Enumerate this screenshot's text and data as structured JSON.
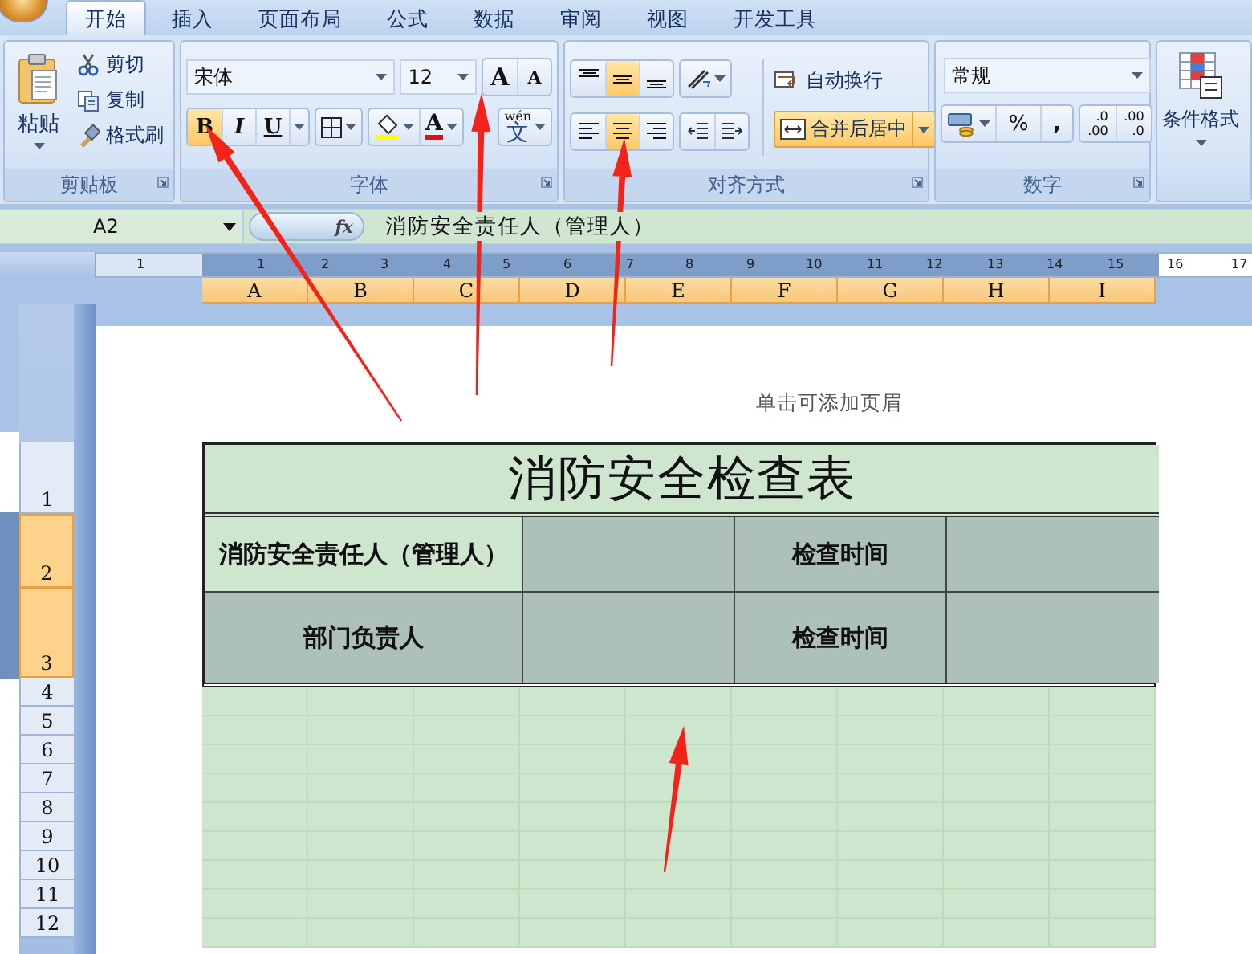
{
  "tabs": [
    {
      "label": "开始",
      "selected": true
    },
    {
      "label": "插入",
      "selected": false
    },
    {
      "label": "页面布局",
      "selected": false
    },
    {
      "label": "公式",
      "selected": false
    },
    {
      "label": "数据",
      "selected": false
    },
    {
      "label": "审阅",
      "selected": false
    },
    {
      "label": "视图",
      "selected": false
    },
    {
      "label": "开发工具",
      "selected": false
    }
  ],
  "ribbon": {
    "clipboard": {
      "label": "剪贴板",
      "paste": "粘贴",
      "items": [
        {
          "kind": "cut",
          "label": "剪切"
        },
        {
          "kind": "copy",
          "label": "复制"
        },
        {
          "kind": "painter",
          "label": "格式刷"
        }
      ]
    },
    "font": {
      "label": "字体",
      "font_name": "宋体",
      "font_size": "12",
      "grow": "A",
      "shrink": "A",
      "bold": {
        "label": "B",
        "selected": true
      },
      "italic": {
        "label": "I",
        "selected": false
      },
      "underline": {
        "label": "U",
        "selected": false
      },
      "font_color": "A",
      "phonetic_top": "wén",
      "phonetic": "文"
    },
    "alignment": {
      "label": "对齐方式",
      "vertical": [
        {
          "kind": "top",
          "selected": false
        },
        {
          "kind": "middle",
          "selected": true
        },
        {
          "kind": "bottom",
          "selected": false
        }
      ],
      "horizontal": [
        {
          "kind": "left",
          "selected": false
        },
        {
          "kind": "center",
          "selected": true
        },
        {
          "kind": "right",
          "selected": false
        }
      ],
      "wrap_text": "自动换行",
      "merge_center": {
        "label": "合并后居中",
        "selected": true
      }
    },
    "number": {
      "label": "数字",
      "format": "常规",
      "percent": "%",
      "comma": ",",
      "increase_decimal": [
        ".0",
        ".00"
      ],
      "decrease_decimal": [
        ".00",
        ".0"
      ]
    },
    "styles": {
      "conditional_format": "条件格式"
    }
  },
  "formula_bar": {
    "name_box": "A2",
    "function_label": "fx",
    "formula": "消防安全责任人（管理人）"
  },
  "ruler": [
    "1",
    "1",
    "2",
    "3",
    "4",
    "5",
    "6",
    "7",
    "8",
    "9",
    "10",
    "11",
    "12",
    "13",
    "14",
    "15",
    "16",
    "17"
  ],
  "columns": [
    {
      "label": "A",
      "selected": true
    },
    {
      "label": "B",
      "selected": true
    },
    {
      "label": "C",
      "selected": true
    },
    {
      "label": "D",
      "selected": true
    },
    {
      "label": "E",
      "selected": true
    },
    {
      "label": "F",
      "selected": true
    },
    {
      "label": "G",
      "selected": true
    },
    {
      "label": "H",
      "selected": true
    },
    {
      "label": "I",
      "selected": true
    }
  ],
  "rows": [
    {
      "label": "1",
      "selected": false
    },
    {
      "label": "2",
      "selected": true
    },
    {
      "label": "3",
      "selected": true
    },
    {
      "label": "4",
      "selected": false
    },
    {
      "label": "5",
      "selected": false
    },
    {
      "label": "6",
      "selected": false
    },
    {
      "label": "7",
      "selected": false
    },
    {
      "label": "8",
      "selected": false
    },
    {
      "label": "9",
      "selected": false
    },
    {
      "label": "10",
      "selected": false
    },
    {
      "label": "11",
      "selected": false
    },
    {
      "label": "12",
      "selected": false
    }
  ],
  "page_header_hint": "单击可添加页眉",
  "sheet": {
    "title": "消防安全检查表",
    "rows": [
      [
        {
          "kind": "label",
          "text": "消防安全责任人（管理人）",
          "highlighted": false
        },
        {
          "kind": "blank",
          "highlighted": true
        },
        {
          "kind": "label",
          "text": "检查时间",
          "highlighted": true
        },
        {
          "kind": "blank",
          "highlighted": true
        }
      ],
      [
        {
          "kind": "label",
          "text": "部门负责人",
          "highlighted": true
        },
        {
          "kind": "blank",
          "highlighted": true
        },
        {
          "kind": "label",
          "text": "检查时间",
          "highlighted": true
        },
        {
          "kind": "blank",
          "highlighted": true
        }
      ]
    ]
  }
}
